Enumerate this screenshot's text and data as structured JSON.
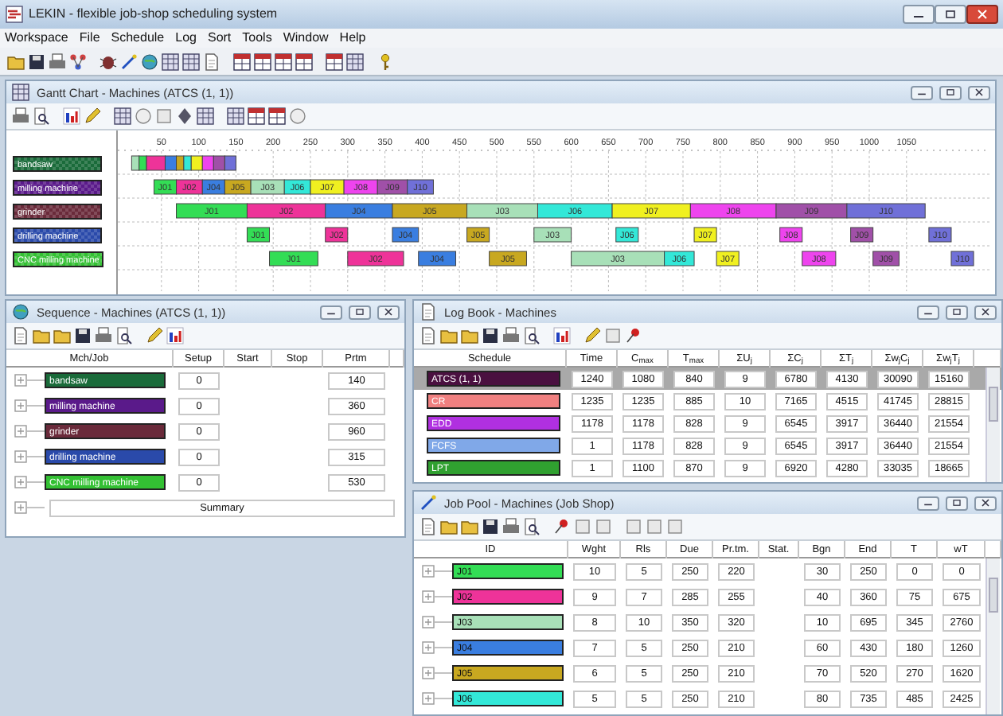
{
  "app": {
    "title": "LEKIN - flexible job-shop scheduling system"
  },
  "menu": [
    "Workspace",
    "File",
    "Schedule",
    "Log",
    "Sort",
    "Tools",
    "Window",
    "Help"
  ],
  "gantt": {
    "title": "Gantt Chart - Machines (ATCS (1, 1))",
    "ticks": [
      "50",
      "100",
      "150",
      "200",
      "250",
      "300",
      "350",
      "400",
      "450",
      "500",
      "550",
      "600",
      "650",
      "700",
      "750",
      "800",
      "850",
      "900",
      "950",
      "1000",
      "1050"
    ],
    "rows": [
      {
        "machine": "bandsaw",
        "color": "#1a6b3a",
        "ops": [
          {
            "color": "#a8e0b8"
          },
          {
            "color": "#33dd55"
          },
          {
            "color": "#ee3399"
          },
          {
            "color": "#3a7ee0"
          },
          {
            "color": "#c8a820"
          },
          {
            "color": "#33e8d8"
          },
          {
            "color": "#f0f020"
          },
          {
            "color": "#ee44ee"
          },
          {
            "color": "#a050a8"
          },
          {
            "color": "#7070d8"
          }
        ]
      },
      {
        "machine": "milling machine",
        "color": "#5a1a8a",
        "ops": [
          {
            "job": "J01",
            "color": "#33dd55"
          },
          {
            "job": "J02",
            "color": "#ee3399"
          },
          {
            "job": "J04",
            "color": "#3a7ee0"
          },
          {
            "job": "J05",
            "color": "#c8a820"
          },
          {
            "job": "J03",
            "color": "#a8e0b8"
          },
          {
            "job": "J06",
            "color": "#33e8d8"
          },
          {
            "job": "J07",
            "color": "#f0f020"
          },
          {
            "job": "J08",
            "color": "#ee44ee"
          },
          {
            "job": "J09",
            "color": "#a050a8"
          },
          {
            "job": "J10",
            "color": "#7070d8"
          }
        ]
      },
      {
        "machine": "grinder",
        "color": "#6a2a3a",
        "ops": [
          {
            "job": "J01",
            "color": "#33dd55"
          },
          {
            "job": "J02",
            "color": "#ee3399"
          },
          {
            "job": "J04",
            "color": "#3a7ee0"
          },
          {
            "job": "J05",
            "color": "#c8a820"
          },
          {
            "job": "J03",
            "color": "#a8e0b8"
          },
          {
            "job": "J06",
            "color": "#33e8d8"
          },
          {
            "job": "J07",
            "color": "#f0f020"
          },
          {
            "job": "J08",
            "color": "#ee44ee"
          },
          {
            "job": "J09",
            "color": "#a050a8"
          },
          {
            "job": "J10",
            "color": "#7070d8"
          }
        ]
      },
      {
        "machine": "drilling machine",
        "color": "#2a4aaa",
        "ops": [
          {
            "job": "J01",
            "color": "#33dd55"
          },
          {
            "job": "J02",
            "color": "#ee3399"
          },
          {
            "job": "J04",
            "color": "#3a7ee0"
          },
          {
            "job": "J05",
            "color": "#c8a820"
          },
          {
            "job": "J03",
            "color": "#a8e0b8"
          },
          {
            "job": "J06",
            "color": "#33e8d8"
          },
          {
            "job": "J07",
            "color": "#f0f020"
          },
          {
            "job": "J08",
            "color": "#ee44ee"
          },
          {
            "job": "J09",
            "color": "#a050a8"
          },
          {
            "job": "J10",
            "color": "#7070d8"
          }
        ]
      },
      {
        "machine": "CNC milling machine",
        "color": "#33c033",
        "ops": [
          {
            "job": "J01",
            "color": "#33dd55"
          },
          {
            "job": "J02",
            "color": "#ee3399"
          },
          {
            "job": "J04",
            "color": "#3a7ee0"
          },
          {
            "job": "J05",
            "color": "#c8a820"
          },
          {
            "job": "J03",
            "color": "#a8e0b8"
          },
          {
            "job": "J06",
            "color": "#33e8d8"
          },
          {
            "job": "J07",
            "color": "#f0f020"
          },
          {
            "job": "J08",
            "color": "#ee44ee"
          },
          {
            "job": "J09",
            "color": "#a050a8"
          },
          {
            "job": "J10",
            "color": "#7070d8"
          }
        ]
      }
    ]
  },
  "sequence": {
    "title": "Sequence - Machines (ATCS (1, 1))",
    "columns": [
      "Mch/Job",
      "Setup",
      "Start",
      "Stop",
      "Prtm"
    ],
    "rows": [
      {
        "machine": "bandsaw",
        "color": "#1a6b3a",
        "setup": "0",
        "prtm": "140"
      },
      {
        "machine": "milling machine",
        "color": "#5a1a8a",
        "setup": "0",
        "prtm": "360"
      },
      {
        "machine": "grinder",
        "color": "#6a2a3a",
        "setup": "0",
        "prtm": "960"
      },
      {
        "machine": "drilling machine",
        "color": "#2a4aaa",
        "setup": "0",
        "prtm": "315"
      },
      {
        "machine": "CNC milling machine",
        "color": "#33c033",
        "setup": "0",
        "prtm": "530"
      }
    ],
    "summary": "Summary"
  },
  "log_book": {
    "title": "Log Book - Machines",
    "columns": [
      "Schedule",
      "Time",
      "C$_{max}$",
      "T$_{max}$",
      "ΣU$_{j}$",
      "ΣC$_{j}$",
      "ΣT$_{j}$",
      "Σw$_{j}$C$_{j}$",
      "Σw$_{j}$T$_{j}$"
    ],
    "rows": [
      {
        "schedule": "ATCS (1, 1)",
        "color": "#4a1040",
        "selected": true,
        "values": [
          "1240",
          "1080",
          "840",
          "9",
          "6780",
          "4130",
          "30090",
          "15160"
        ]
      },
      {
        "schedule": "CR",
        "color": "#f08080",
        "selected": false,
        "values": [
          "1235",
          "1235",
          "885",
          "10",
          "7165",
          "4515",
          "41745",
          "28815"
        ]
      },
      {
        "schedule": "EDD",
        "color": "#b030e0",
        "selected": false,
        "values": [
          "1178",
          "1178",
          "828",
          "9",
          "6545",
          "3917",
          "36440",
          "21554"
        ]
      },
      {
        "schedule": "FCFS",
        "color": "#80a8e8",
        "selected": false,
        "values": [
          "1",
          "1178",
          "828",
          "9",
          "6545",
          "3917",
          "36440",
          "21554"
        ]
      },
      {
        "schedule": "LPT",
        "color": "#30a030",
        "selected": false,
        "values": [
          "1",
          "1100",
          "870",
          "9",
          "6920",
          "4280",
          "33035",
          "18665"
        ]
      }
    ]
  },
  "job_pool": {
    "title": "Job Pool - Machines (Job Shop)",
    "columns": [
      "ID",
      "Wght",
      "Rls",
      "Due",
      "Pr.tm.",
      "Stat.",
      "Bgn",
      "End",
      "T",
      "wT"
    ],
    "rows": [
      {
        "id": "J01",
        "color": "#33dd55",
        "wght": "10",
        "rls": "5",
        "due": "250",
        "pr_tm": "220",
        "bgn": "30",
        "end": "250",
        "t": "0",
        "wt": "0"
      },
      {
        "id": "J02",
        "color": "#ee3399",
        "wght": "9",
        "rls": "7",
        "due": "285",
        "pr_tm": "255",
        "bgn": "40",
        "end": "360",
        "t": "75",
        "wt": "675"
      },
      {
        "id": "J03",
        "color": "#a8e0b8",
        "wght": "8",
        "rls": "10",
        "due": "350",
        "pr_tm": "320",
        "bgn": "10",
        "end": "695",
        "t": "345",
        "wt": "2760"
      },
      {
        "id": "J04",
        "color": "#3a7ee0",
        "wght": "7",
        "rls": "5",
        "due": "250",
        "pr_tm": "210",
        "bgn": "60",
        "end": "430",
        "t": "180",
        "wt": "1260"
      },
      {
        "id": "J05",
        "color": "#c8a820",
        "wght": "6",
        "rls": "5",
        "due": "250",
        "pr_tm": "210",
        "bgn": "70",
        "end": "520",
        "t": "270",
        "wt": "1620"
      },
      {
        "id": "J06",
        "color": "#33e8d8",
        "wght": "5",
        "rls": "5",
        "due": "250",
        "pr_tm": "210",
        "bgn": "80",
        "end": "735",
        "t": "485",
        "wt": "2425"
      }
    ]
  }
}
